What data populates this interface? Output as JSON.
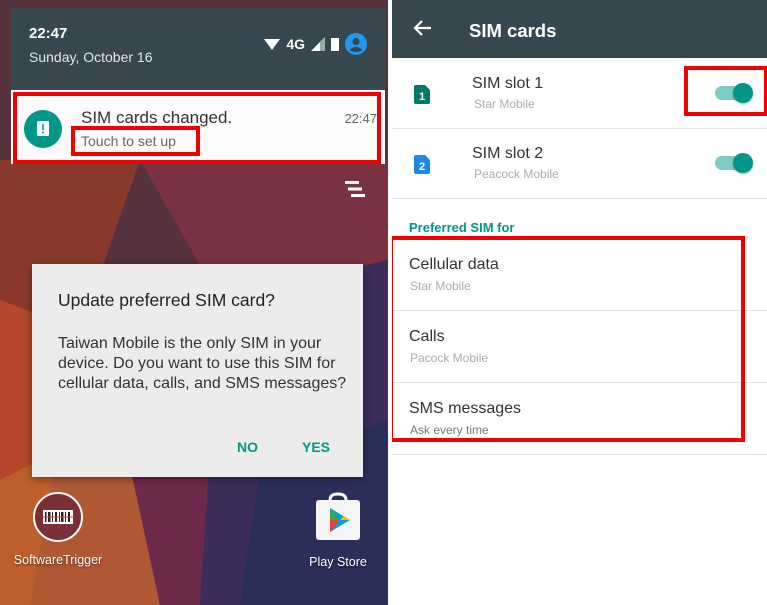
{
  "left": {
    "status": {
      "time": "22:47",
      "date": "Sunday, October 16",
      "network": "4G"
    },
    "notification": {
      "title": "SIM cards changed.",
      "subtitle": "Touch to set up",
      "time": "22:47"
    },
    "dialog": {
      "title": "Update preferred SIM card?",
      "body": "Taiwan Mobile is the only SIM in your device. Do you want to use this SIM for cellular data, calls, and SMS messages?",
      "no_label": "NO",
      "yes_label": "YES"
    },
    "apps": [
      {
        "label": "SoftwareTrigger"
      },
      {
        "label": "Play Store"
      }
    ]
  },
  "right": {
    "title": "SIM cards",
    "sim_slots": [
      {
        "name": "SIM slot 1",
        "carrier": "Star Mobile",
        "badge": "1",
        "enabled": true
      },
      {
        "name": "SIM slot 2",
        "carrier": "Peacock Mobile",
        "badge": "2",
        "enabled": true
      }
    ],
    "preferred_header": "Preferred SIM for",
    "preferred": [
      {
        "title": "Cellular data",
        "value": "Star Mobile"
      },
      {
        "title": "Calls",
        "value": "Pacock Mobile"
      },
      {
        "title": "SMS messages",
        "value": "Ask every time"
      }
    ]
  },
  "colors": {
    "accent": "#009688",
    "toolbar": "#37474f",
    "highlight": "#f20000"
  }
}
